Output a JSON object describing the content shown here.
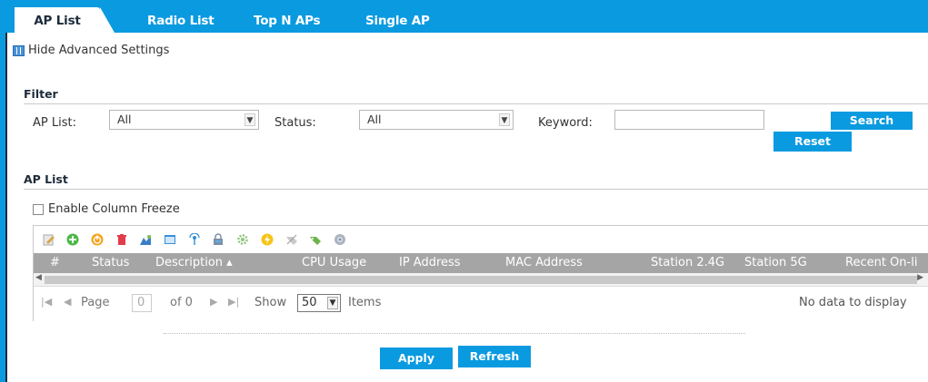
{
  "tabs": [
    {
      "label": "AP List",
      "active": true
    },
    {
      "label": "Radio List",
      "active": false
    },
    {
      "label": "Top N APs",
      "active": false
    },
    {
      "label": "Single AP",
      "active": false
    }
  ],
  "advanced_link": "Hide Advanced Settings",
  "filter": {
    "title": "Filter",
    "ap_list_label": "AP List:",
    "ap_list_value": "All",
    "status_label": "Status:",
    "status_value": "All",
    "keyword_label": "Keyword:",
    "keyword_value": "",
    "search_label": "Search",
    "reset_label": "Reset"
  },
  "ap_list": {
    "title": "AP List",
    "column_freeze_label": "Enable Column Freeze",
    "toolbar_icons": [
      "edit-icon",
      "add-icon",
      "power-icon",
      "delete-icon",
      "promote-icon",
      "window-icon",
      "antenna-icon",
      "lock-icon",
      "gear-icon",
      "flash-icon",
      "unlink-icon",
      "link-icon",
      "settings-icon"
    ],
    "columns": [
      "#",
      "Status",
      "Description ▴",
      "CPU Usage",
      "IP Address",
      "MAC Address",
      "Station 2.4G",
      "Station 5G",
      "Recent On-li"
    ],
    "pager": {
      "page_label": "Page",
      "page_value": "0",
      "of_label": "of 0",
      "show_label": "Show",
      "show_value": "50",
      "items_label": "Items",
      "empty_text": "No data to display"
    }
  },
  "actions": {
    "apply_label": "Apply",
    "refresh_label": "Refresh"
  },
  "colors": {
    "accent": "#0a9ae0",
    "header_gray": "#a5a5a5"
  }
}
